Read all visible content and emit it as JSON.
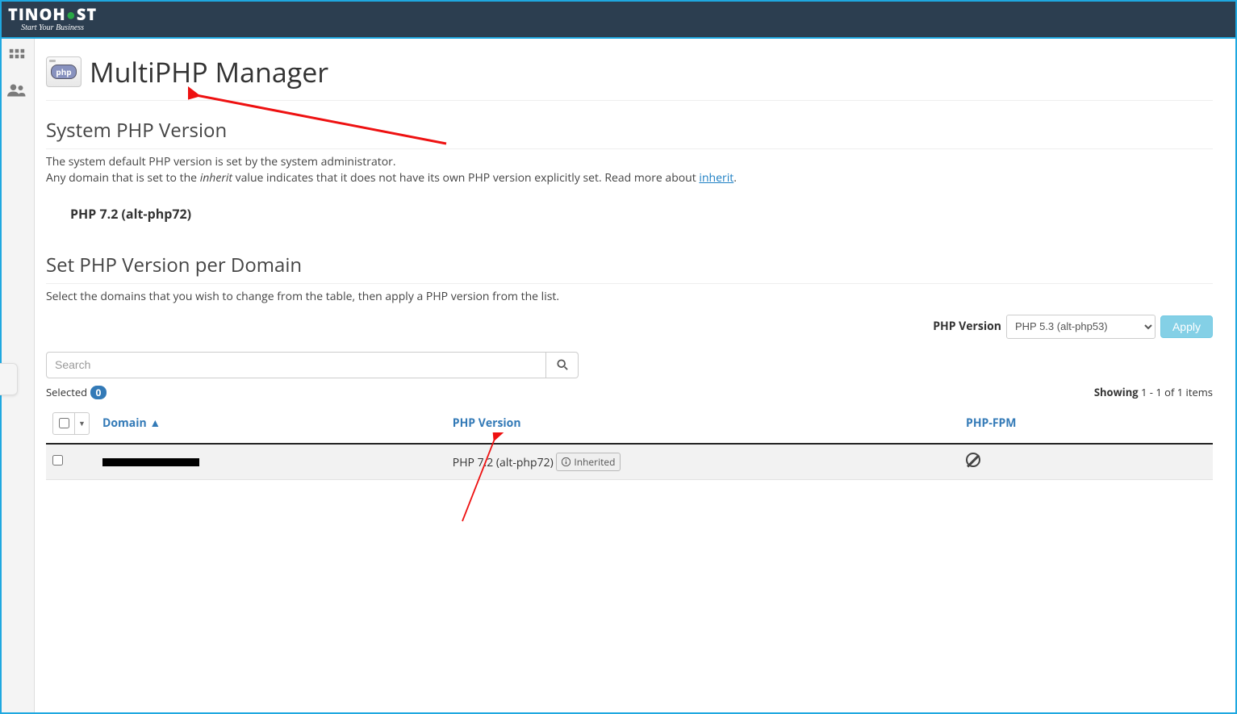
{
  "brand": {
    "name": "TINOHOST",
    "tagline": "Start Your Business"
  },
  "page": {
    "title": "MultiPHP Manager",
    "icon_label": "php"
  },
  "system_php": {
    "heading": "System PHP Version",
    "line1": "The system default PHP version is set by the system administrator.",
    "line2_pre": "Any domain that is set to the ",
    "line2_em": "inherit",
    "line2_mid": " value indicates that it does not have its own PHP version explicitly set. Read more about ",
    "line2_link": "inherit",
    "line2_post": ".",
    "current": "PHP 7.2 (alt-php72)"
  },
  "per_domain": {
    "heading": "Set PHP Version per Domain",
    "desc": "Select the domains that you wish to change from the table, then apply a PHP version from the list.",
    "label": "PHP Version",
    "selected_option": "PHP 5.3 (alt-php53)",
    "apply": "Apply"
  },
  "search": {
    "placeholder": "Search"
  },
  "meta": {
    "selected_label": "Selected",
    "selected_count": "0",
    "showing_label": "Showing",
    "showing_range": "1 - 1 of 1 items"
  },
  "table": {
    "col_domain": "Domain ▲",
    "col_php": "PHP Version",
    "col_fpm": "PHP-FPM",
    "rows": [
      {
        "domain_redacted": true,
        "php": "PHP 7.2 (alt-php72)",
        "inherited_label": "Inherited"
      }
    ]
  }
}
